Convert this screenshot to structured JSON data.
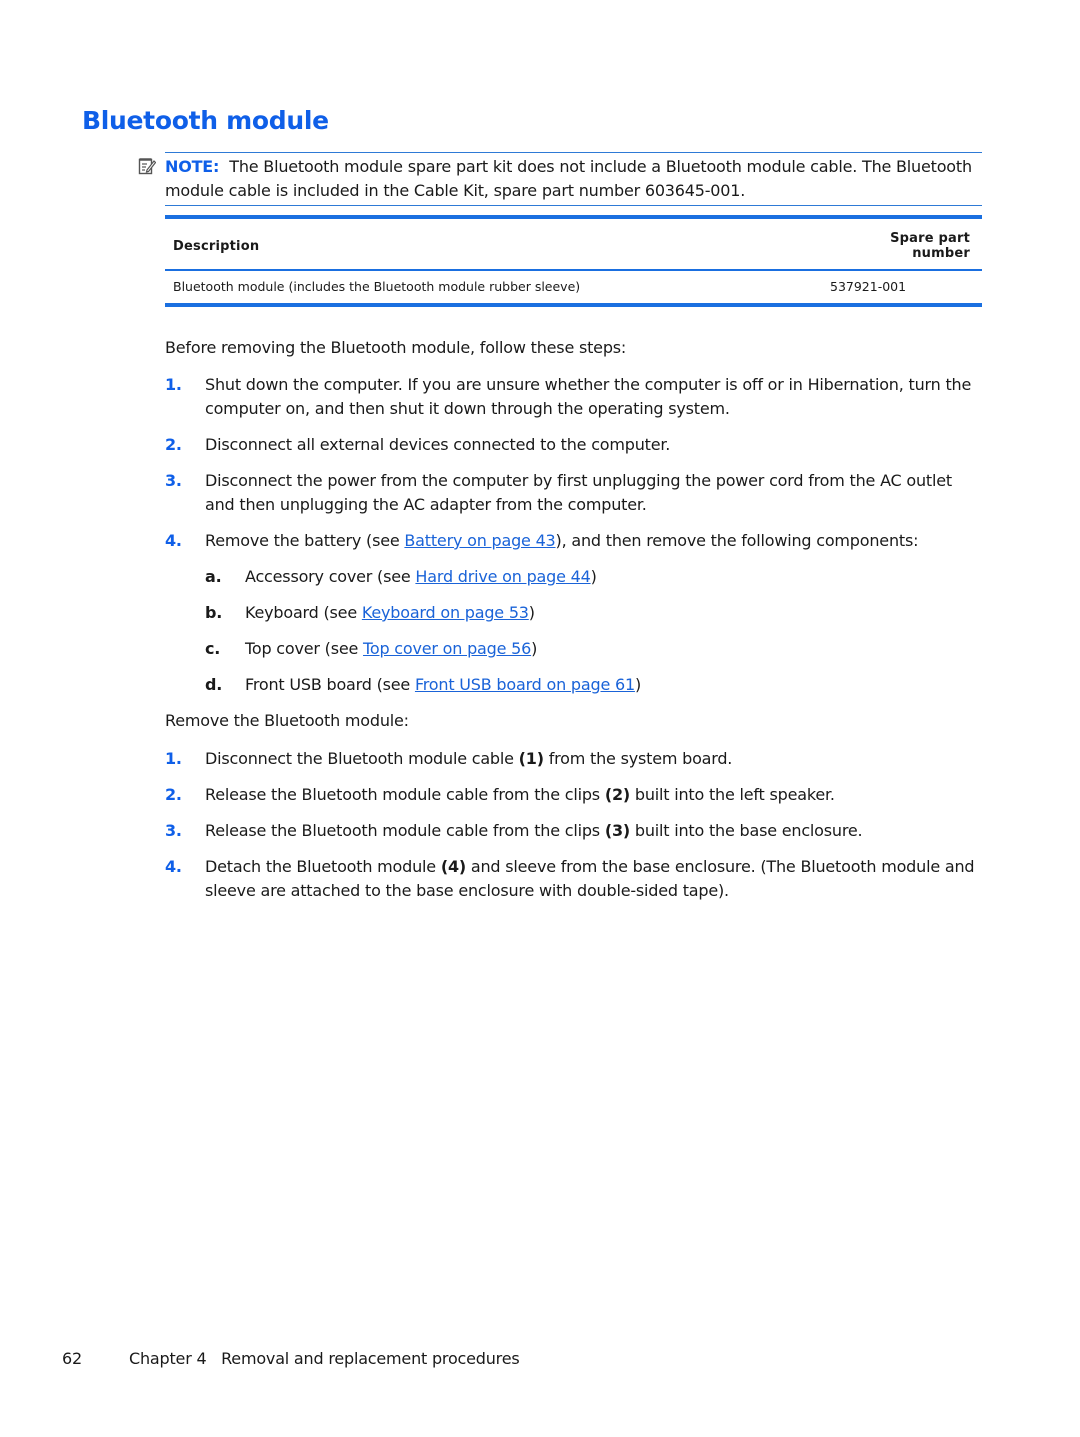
{
  "page": {
    "title": "Bluetooth module",
    "accent_color": "#0f5fe8"
  },
  "note": {
    "icon": "note-pencil-icon",
    "label": "NOTE:",
    "text": "The Bluetooth module spare part kit does not include a Bluetooth module cable. The Bluetooth module cable is included in the Cable Kit, spare part number 603645-001."
  },
  "parts_table": {
    "headers": [
      "Description",
      "Spare part number"
    ],
    "rows": [
      [
        "Bluetooth module (includes the Bluetooth module rubber sleeve)",
        "537921-001"
      ]
    ]
  },
  "prep": {
    "intro": "Before removing the Bluetooth module, follow these steps:",
    "steps": [
      {
        "num": "1.",
        "text": "Shut down the computer. If you are unsure whether the computer is off or in Hibernation, turn the computer on, and then shut it down through the operating system."
      },
      {
        "num": "2.",
        "text": "Disconnect all external devices connected to the computer."
      },
      {
        "num": "3.",
        "text": "Disconnect the power from the computer by first unplugging the power cord from the AC outlet and then unplugging the AC adapter from the computer."
      },
      {
        "num": "4.",
        "before": "Remove the battery (see ",
        "link": "Battery on page 43",
        "after": "), and then remove the following components:",
        "substeps": [
          {
            "letter": "a.",
            "before": "Accessory cover (see ",
            "link": "Hard drive on page 44",
            "after": ")"
          },
          {
            "letter": "b.",
            "before": "Keyboard (see ",
            "link": "Keyboard on page 53",
            "after": ")"
          },
          {
            "letter": "c.",
            "before": "Top cover (see ",
            "link": "Top cover on page 56",
            "after": ")"
          },
          {
            "letter": "d.",
            "before": "Front USB board (see ",
            "link": "Front USB board on page 61",
            "after": ")"
          }
        ]
      }
    ]
  },
  "removal": {
    "intro": "Remove the Bluetooth module:",
    "steps": [
      {
        "num": "1.",
        "before": "Disconnect the Bluetooth module cable ",
        "callout": "(1)",
        "after": " from the system board."
      },
      {
        "num": "2.",
        "before": "Release the Bluetooth module cable from the clips ",
        "callout": "(2)",
        "after": " built into the left speaker."
      },
      {
        "num": "3.",
        "before": "Release the Bluetooth module cable from the clips ",
        "callout": "(3)",
        "after": " built into the base enclosure."
      },
      {
        "num": "4.",
        "before": "Detach the Bluetooth module ",
        "callout": "(4)",
        "after": " and sleeve from the base enclosure. (The Bluetooth module and sleeve are attached to the base enclosure with double-sided tape)."
      }
    ]
  },
  "footer": {
    "page_number": "62",
    "chapter": "Chapter 4",
    "chapter_title": "Removal and replacement procedures"
  }
}
